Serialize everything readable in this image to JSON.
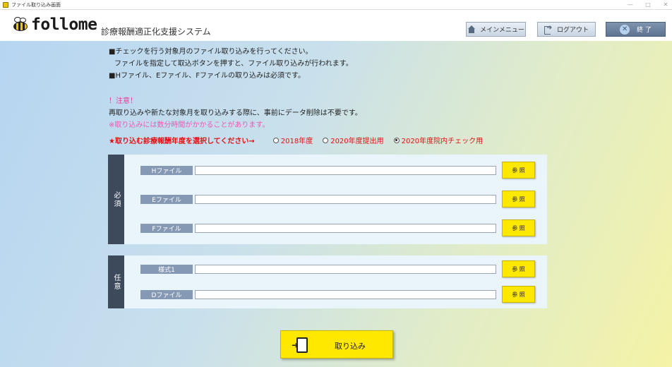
{
  "window": {
    "title": "ファイル取り込み画面",
    "controls": [
      "—",
      "□",
      "✕"
    ]
  },
  "header": {
    "logo_text": "follome",
    "system_name": "診療報酬適正化支援システム",
    "buttons": {
      "main_menu": "メインメニュー",
      "logout": "ログアウト",
      "exit": "終 了"
    }
  },
  "instructions": {
    "line1": "■チェックを行う対象月のファイル取り込みを行ってください。",
    "line2": "ファイルを指定して取込ボタンを押すと、ファイル取り込みが行われます。",
    "line3": "■Hファイル、Eファイル、Fファイルの取り込みは必須です。",
    "note_title": "！注意！",
    "note1": "再取り込みや新たな対象月を取り込みする際に、事前にデータ削除は不要です。",
    "note2": "※取り込みには数分時間がかかることがあります。"
  },
  "year_select": {
    "prompt": "★取り込む診療報酬年度を選択してください→",
    "options": [
      "2018年度",
      "2020年度提出用",
      "2020年度院内チェック用"
    ],
    "selected_index": 2
  },
  "required_panel": {
    "side_label": "必須",
    "rows": [
      {
        "label": "Hファイル",
        "value": "",
        "browse": "参 照"
      },
      {
        "label": "Eファイル",
        "value": "",
        "browse": "参 照"
      },
      {
        "label": "Fファイル",
        "value": "",
        "browse": "参 照"
      }
    ]
  },
  "optional_panel": {
    "side_label": "任意",
    "rows": [
      {
        "label": "様式1",
        "value": "",
        "browse": "参 照"
      },
      {
        "label": "Dファイル",
        "value": "",
        "browse": "参 照"
      }
    ]
  },
  "import_button": {
    "label": "取り込み"
  }
}
